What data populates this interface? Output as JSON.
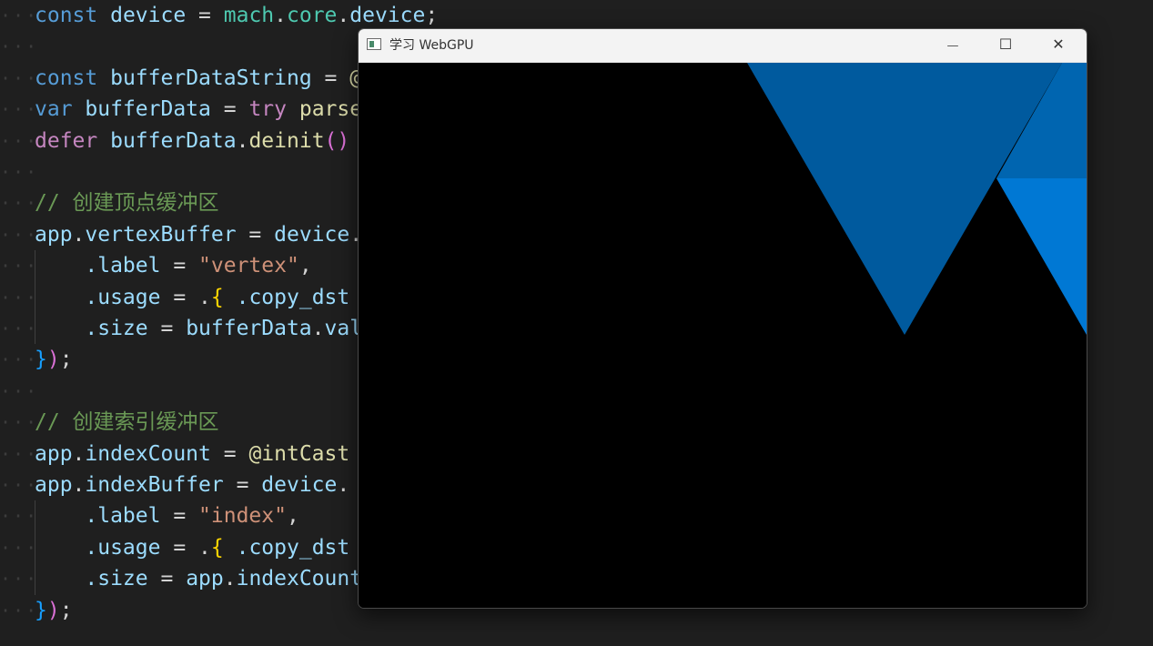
{
  "editor": {
    "lines": [
      {
        "tokens": [
          {
            "t": "const",
            "c": "kw"
          },
          {
            "t": " "
          },
          {
            "t": "device",
            "c": "var"
          },
          {
            "t": " = ",
            "c": "op"
          },
          {
            "t": "mach",
            "c": "ty"
          },
          {
            "t": ".",
            "c": "op"
          },
          {
            "t": "core",
            "c": "ty"
          },
          {
            "t": ".",
            "c": "op"
          },
          {
            "t": "device",
            "c": "var"
          },
          {
            "t": ";",
            "c": "op"
          }
        ]
      },
      {
        "tokens": []
      },
      {
        "tokens": [
          {
            "t": "const",
            "c": "kw"
          },
          {
            "t": " "
          },
          {
            "t": "bufferDataString",
            "c": "var"
          },
          {
            "t": " = ",
            "c": "op"
          },
          {
            "t": "@",
            "c": "fn"
          }
        ]
      },
      {
        "tokens": [
          {
            "t": "var",
            "c": "kw"
          },
          {
            "t": " "
          },
          {
            "t": "bufferData",
            "c": "var"
          },
          {
            "t": " = ",
            "c": "op"
          },
          {
            "t": "try",
            "c": "kw2"
          },
          {
            "t": " "
          },
          {
            "t": "parse",
            "c": "fn"
          }
        ]
      },
      {
        "tokens": [
          {
            "t": "defer",
            "c": "kw2"
          },
          {
            "t": " "
          },
          {
            "t": "bufferData",
            "c": "var"
          },
          {
            "t": ".",
            "c": "op"
          },
          {
            "t": "deinit",
            "c": "fn"
          },
          {
            "t": "()",
            "c": "p2"
          }
        ]
      },
      {
        "tokens": []
      },
      {
        "tokens": [
          {
            "t": "// 创建顶点缓冲区",
            "c": "cm"
          }
        ]
      },
      {
        "tokens": [
          {
            "t": "app",
            "c": "var"
          },
          {
            "t": ".",
            "c": "op"
          },
          {
            "t": "vertexBuffer",
            "c": "var"
          },
          {
            "t": " = ",
            "c": "op"
          },
          {
            "t": "device",
            "c": "var"
          },
          {
            "t": ".",
            "c": "op"
          }
        ]
      },
      {
        "tokens": [
          {
            "t": "    "
          },
          {
            "t": ".label",
            "c": "var"
          },
          {
            "t": " = ",
            "c": "op"
          },
          {
            "t": "\"vertex\"",
            "c": "str"
          },
          {
            "t": ",",
            "c": "op"
          }
        ]
      },
      {
        "tokens": [
          {
            "t": "    "
          },
          {
            "t": ".usage",
            "c": "var"
          },
          {
            "t": " = ",
            "c": "op"
          },
          {
            "t": ".",
            "c": "op"
          },
          {
            "t": "{",
            "c": "p1"
          },
          {
            "t": " "
          },
          {
            "t": ".copy_dst",
            "c": "var"
          }
        ]
      },
      {
        "tokens": [
          {
            "t": "    "
          },
          {
            "t": ".size",
            "c": "var"
          },
          {
            "t": " = ",
            "c": "op"
          },
          {
            "t": "bufferData",
            "c": "var"
          },
          {
            "t": ".",
            "c": "op"
          },
          {
            "t": "val",
            "c": "var"
          }
        ]
      },
      {
        "tokens": [
          {
            "t": "}",
            "c": "p3"
          },
          {
            "t": ")",
            "c": "p2"
          },
          {
            "t": ";",
            "c": "op"
          }
        ]
      },
      {
        "tokens": []
      },
      {
        "tokens": [
          {
            "t": "// 创建索引缓冲区",
            "c": "cm"
          }
        ]
      },
      {
        "tokens": [
          {
            "t": "app",
            "c": "var"
          },
          {
            "t": ".",
            "c": "op"
          },
          {
            "t": "indexCount",
            "c": "var"
          },
          {
            "t": " = ",
            "c": "op"
          },
          {
            "t": "@intCast",
            "c": "fn"
          }
        ]
      },
      {
        "tokens": [
          {
            "t": "app",
            "c": "var"
          },
          {
            "t": ".",
            "c": "op"
          },
          {
            "t": "indexBuffer",
            "c": "var"
          },
          {
            "t": " = ",
            "c": "op"
          },
          {
            "t": "device",
            "c": "var"
          },
          {
            "t": ".",
            "c": "op"
          }
        ]
      },
      {
        "tokens": [
          {
            "t": "    "
          },
          {
            "t": ".label",
            "c": "var"
          },
          {
            "t": " = ",
            "c": "op"
          },
          {
            "t": "\"index\"",
            "c": "str"
          },
          {
            "t": ",",
            "c": "op"
          }
        ]
      },
      {
        "tokens": [
          {
            "t": "    "
          },
          {
            "t": ".usage",
            "c": "var"
          },
          {
            "t": " = ",
            "c": "op"
          },
          {
            "t": ".",
            "c": "op"
          },
          {
            "t": "{",
            "c": "p1"
          },
          {
            "t": " "
          },
          {
            "t": ".copy_dst",
            "c": "var"
          }
        ]
      },
      {
        "tokens": [
          {
            "t": "    "
          },
          {
            "t": ".size",
            "c": "var"
          },
          {
            "t": " = ",
            "c": "op"
          },
          {
            "t": "app",
            "c": "var"
          },
          {
            "t": ".",
            "c": "op"
          },
          {
            "t": "indexCount",
            "c": "var"
          }
        ]
      },
      {
        "tokens": [
          {
            "t": "}",
            "c": "p3"
          },
          {
            "t": ")",
            "c": "p2"
          },
          {
            "t": ";",
            "c": "op"
          }
        ]
      }
    ]
  },
  "window": {
    "title": "学习 WebGPU",
    "icons": {
      "app": "app-window-icon",
      "minimize": "minimize-icon",
      "maximize": "maximize-icon",
      "close": "close-icon"
    },
    "glyphs": {
      "minimize": "—",
      "maximize": "☐",
      "close": "✕"
    }
  },
  "colors": {
    "editor_bg": "#1f1f1f",
    "triangle_dark": "#005a9e",
    "triangle_light": "#0078d4",
    "canvas_bg": "#000000"
  }
}
